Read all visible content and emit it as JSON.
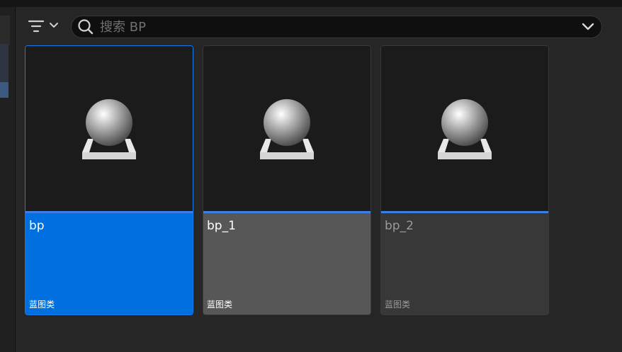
{
  "toolbar": {
    "filter_icon": "filter-icon",
    "search": {
      "placeholder": "搜索 BP",
      "value": ""
    },
    "dropdown_icon": "chevron-down-icon"
  },
  "assets": [
    {
      "name": "bp",
      "type": "蓝图类",
      "selected": true,
      "icon": "blueprint-sphere-icon"
    },
    {
      "name": "bp_1",
      "type": "蓝图类",
      "selected": false,
      "icon": "blueprint-sphere-icon"
    },
    {
      "name": "bp_2",
      "type": "蓝图类",
      "selected": false,
      "icon": "blueprint-sphere-icon"
    }
  ],
  "colors": {
    "selection_blue": "#0070e0",
    "accent_blue": "#3a7ee6",
    "background": "#262626"
  }
}
